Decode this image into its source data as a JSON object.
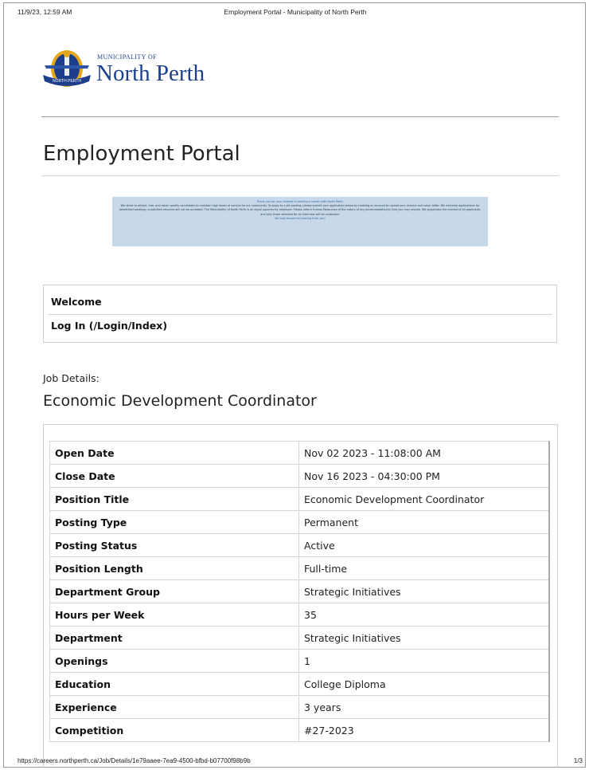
{
  "print_header": {
    "date": "11/9/23, 12:59 AM",
    "title": "Employment Portal - Municipality of North Perth"
  },
  "logo": {
    "municipality_of": "MUNICIPALITY OF",
    "name": "North Perth",
    "seal_text": "NORTH PERTH",
    "icon": "municipal-seal-icon"
  },
  "page_title": "Employment Portal",
  "banner": {
    "lead": "Thank you for your interest in starting a career with North Perth.",
    "body": "We strive to attract, hire, and retain quality candidates to maintain high levels of service for our community. To apply to a job posting, please submit your application below by creating an account to upload your resume and cover letter. We welcome applications for advertised postings, unsolicited resumes will not be accepted. The Municipality of North Perth is an equal opportunity employer. Please inform Human Resources of the nature of any accommodation(s) that you may require. We appreciate the interest of all applicants, and only those selected for an interview will be contacted.",
    "close": "We look forward to hearing from you!"
  },
  "nav": {
    "welcome": "Welcome",
    "login": "Log In (/Login/Index)"
  },
  "job": {
    "label": "Job Details:",
    "title": "Economic Development Coordinator",
    "rows": [
      {
        "key": "Open Date",
        "value": "Nov 02 2023 - 11:08:00 AM"
      },
      {
        "key": "Close Date",
        "value": "Nov 16 2023 - 04:30:00 PM"
      },
      {
        "key": "Position Title",
        "value": "Economic Development Coordinator"
      },
      {
        "key": "Posting Type",
        "value": "Permanent"
      },
      {
        "key": "Posting Status",
        "value": "Active"
      },
      {
        "key": "Position Length",
        "value": "Full-time"
      },
      {
        "key": "Department Group",
        "value": "Strategic Initiatives"
      },
      {
        "key": "Hours per Week",
        "value": "35"
      },
      {
        "key": "Department",
        "value": "Strategic Initiatives"
      },
      {
        "key": "Openings",
        "value": "1"
      },
      {
        "key": "Education",
        "value": "College Diploma"
      },
      {
        "key": "Experience",
        "value": "3 years"
      },
      {
        "key": "Competition",
        "value": "#27-2023"
      }
    ]
  },
  "print_footer": {
    "url": "https://careers.northperth.ca/Job/Details/1e79aaee-7ea9-4500-bfbd-b07700f98b9b",
    "page": "1/3"
  },
  "colors": {
    "brand_blue": "#1d3e8a",
    "banner_bg": "#c7d9e8",
    "seal_gold": "#e3a81b"
  }
}
